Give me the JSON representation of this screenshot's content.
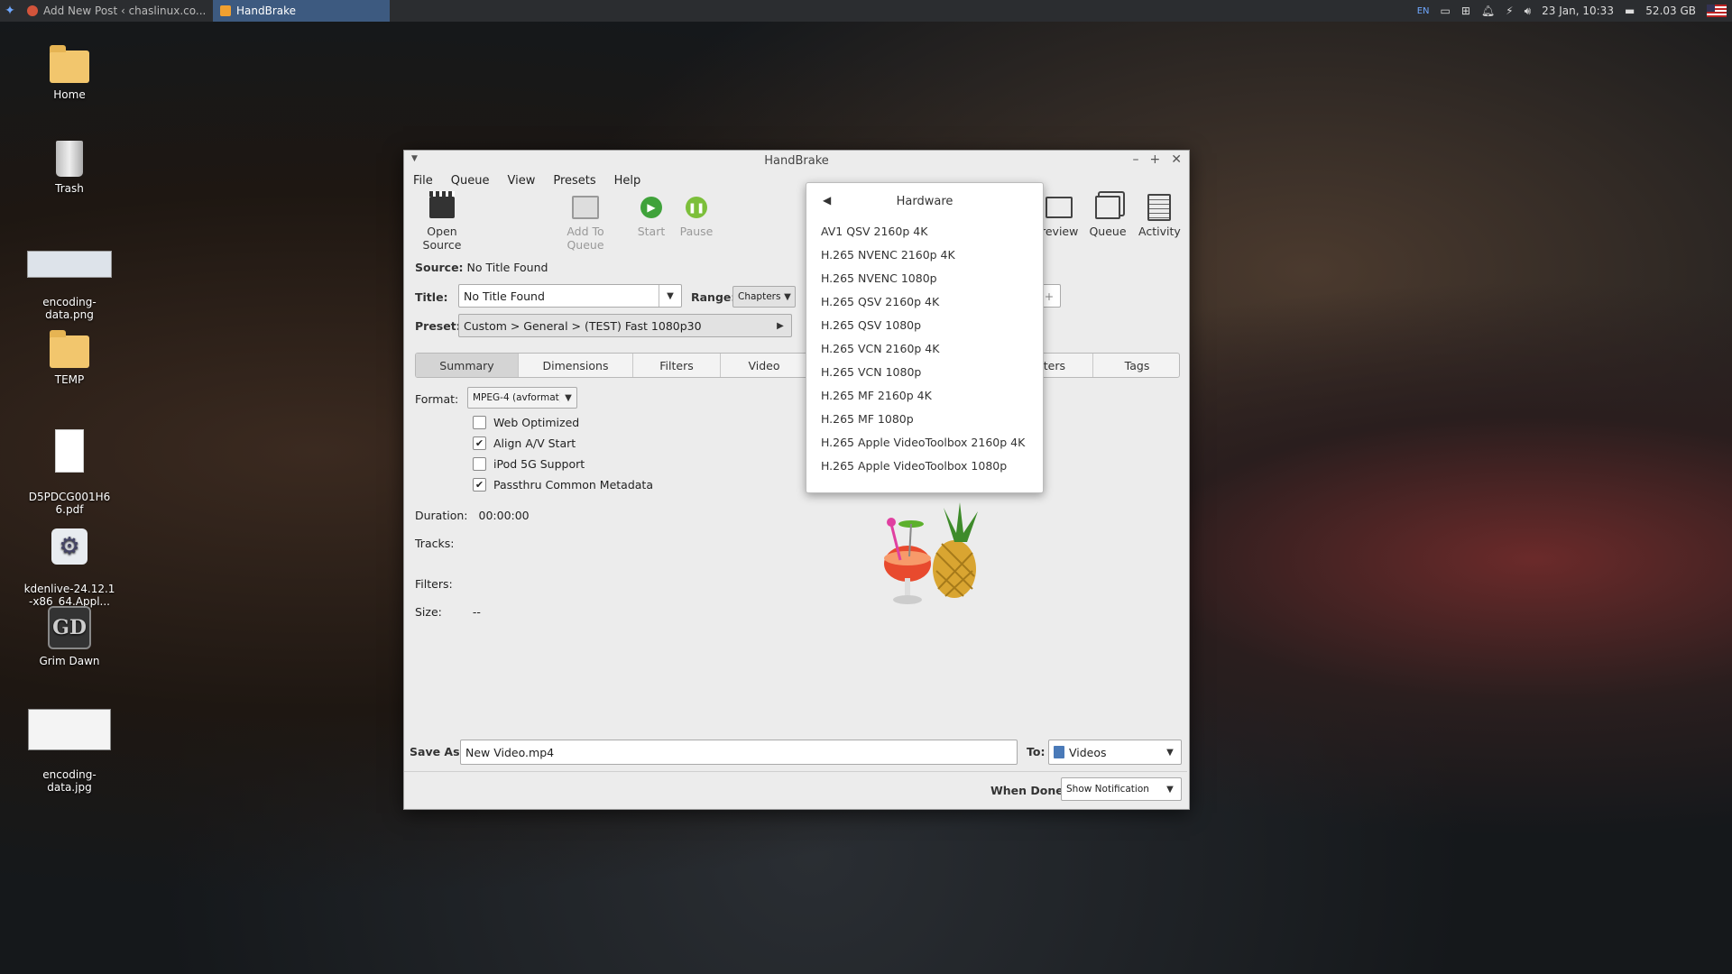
{
  "taskbar": {
    "tasks": [
      {
        "label": "Add New Post ‹ chaslinux.co..."
      },
      {
        "label": "HandBrake"
      }
    ],
    "tray": {
      "lang": "EN",
      "datetime": "23 Jan, 10:33",
      "disk": "52.03 GB"
    }
  },
  "desktop": {
    "icons": [
      {
        "label": "Home"
      },
      {
        "label": "Trash"
      },
      {
        "label": "encoding-\ndata.png"
      },
      {
        "label": "TEMP"
      },
      {
        "label": "D5PDCG001H6\n6.pdf"
      },
      {
        "label": "kdenlive-24.12.1\n-x86_64.Appl..."
      },
      {
        "label": "Grim Dawn"
      },
      {
        "label": "encoding-\ndata.jpg"
      }
    ]
  },
  "window": {
    "title": "HandBrake",
    "menu": [
      "File",
      "Queue",
      "View",
      "Presets",
      "Help"
    ],
    "toolbar": {
      "open_source": "Open Source",
      "add_to_queue": "Add To Queue",
      "start": "Start",
      "pause": "Pause",
      "preview": "review",
      "queue": "Queue",
      "activity": "Activity"
    },
    "source_label": "Source:",
    "source_value": "No Title Found",
    "title_label": "Title:",
    "title_value": "No Title Found",
    "range_label": "Range:",
    "range_value": "Chapters:",
    "range_plus": "+",
    "preset_label": "Preset:",
    "preset_value": "Custom > General > (TEST) Fast 1080p30",
    "tabs": [
      "Summary",
      "Dimensions",
      "Filters",
      "Video",
      "ters",
      "Tags"
    ],
    "format_label": "Format:",
    "format_value": "MPEG-4 (avformat)",
    "checkboxes": [
      {
        "label": "Web Optimized",
        "checked": false
      },
      {
        "label": "Align A/V Start",
        "checked": true
      },
      {
        "label": "iPod 5G Support",
        "checked": false
      },
      {
        "label": "Passthru Common Metadata",
        "checked": true
      }
    ],
    "duration_label": "Duration:",
    "duration_value": "00:00:00",
    "tracks_label": "Tracks:",
    "filters_label": "Filters:",
    "size_label": "Size:",
    "size_value": "--",
    "save_as_label": "Save As:",
    "save_as_value": "New Video.mp4",
    "to_label": "To:",
    "to_value": "Videos",
    "when_done_label": "When Done:",
    "when_done_value": "Show Notification"
  },
  "popup": {
    "header": "Hardware",
    "items": [
      "AV1 QSV 2160p 4K",
      "H.265 NVENC 2160p 4K",
      "H.265 NVENC 1080p",
      "H.265 QSV 2160p 4K",
      "H.265 QSV 1080p",
      "H.265 VCN 2160p 4K",
      "H.265 VCN 1080p",
      "H.265 MF 2160p 4K",
      "H.265 MF 1080p",
      "H.265 Apple VideoToolbox 2160p 4K",
      "H.265 Apple VideoToolbox 1080p"
    ]
  }
}
